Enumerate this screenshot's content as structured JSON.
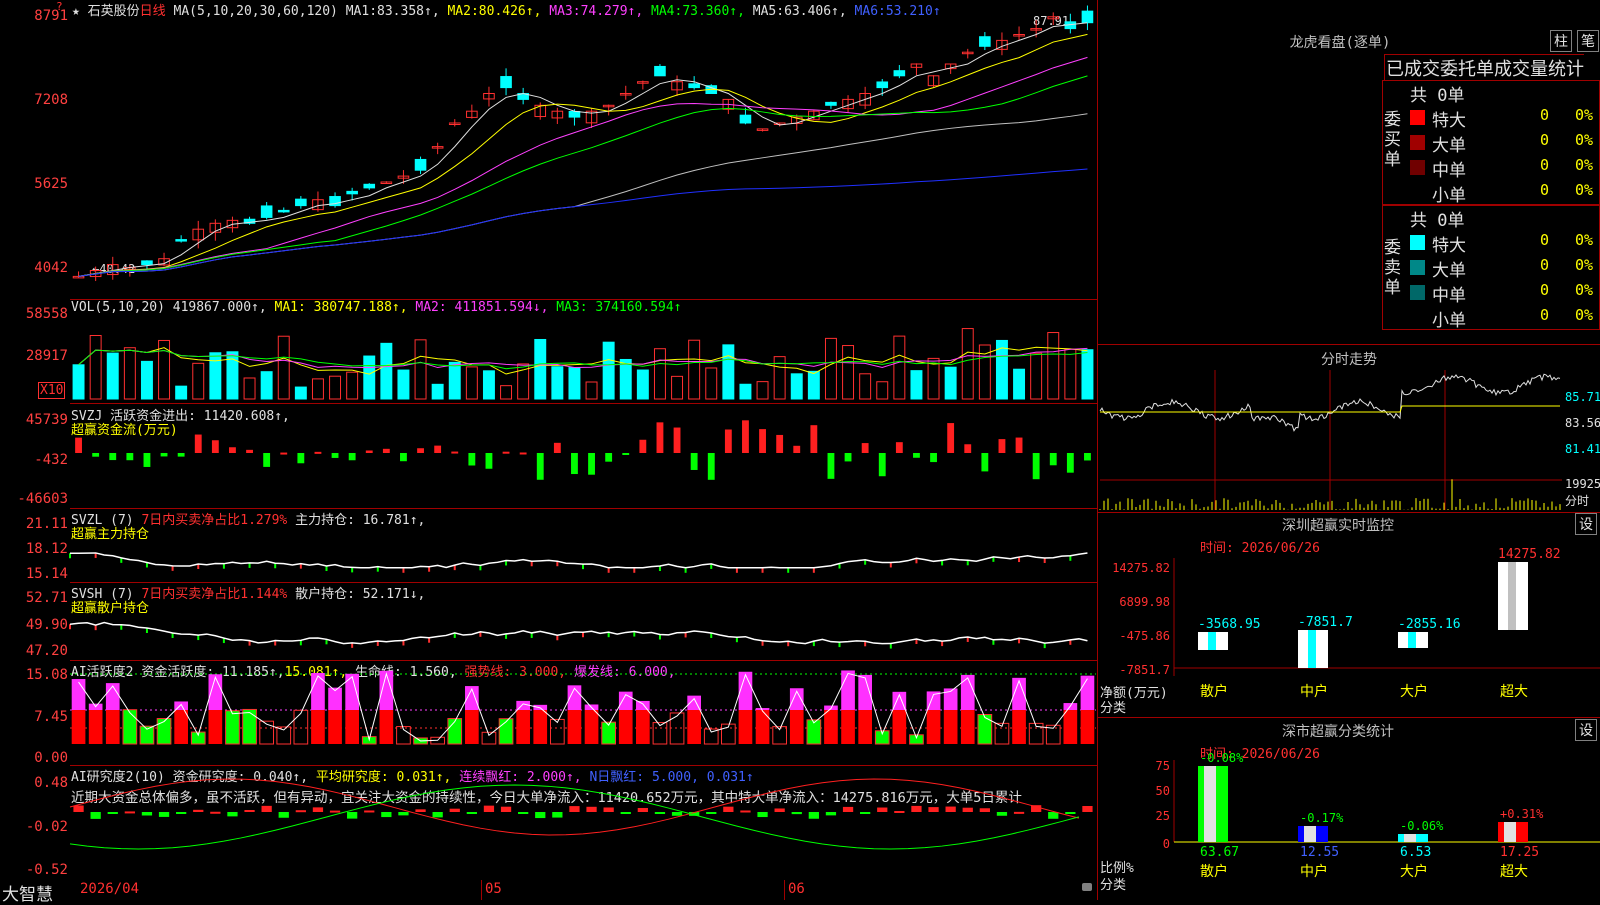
{
  "main": {
    "stock": "石英股份",
    "period": "日线",
    "ma_params": "MA(5,10,20,30,60,120)",
    "ma1_label": "MA1:",
    "ma1": "83.358↑,",
    "ma2_label": "MA2:",
    "ma2": "80.426↑,",
    "ma3_label": "MA3:",
    "ma3": "74.279↑,",
    "ma4_label": "MA4:",
    "ma4": "73.360↑,",
    "ma5_label": "MA5:",
    "ma5": "63.406↑,",
    "ma6_label": "MA6:",
    "ma6": "53.210↑",
    "high_label": "87.91",
    "low_label": "←40.42",
    "axis": [
      "8791",
      "7208",
      "5625",
      "4042"
    ]
  },
  "vol": {
    "params": "VOL(5,10,20)",
    "value": "419867.000↑,",
    "ma1": "MA1: 380747.188↑,",
    "ma2": "MA2: 411851.594↓,",
    "ma3": "MA3: 374160.594↑",
    "axis": [
      "58558",
      "28917"
    ],
    "unit": "X10"
  },
  "svzj": {
    "line1": "SVZJ  活跃资金进出: 11420.608↑,",
    "line2": "超赢资金流(万元)",
    "axis": [
      "45739",
      "-432",
      "-46603"
    ]
  },
  "svzl": {
    "name": "SVZL (7)",
    "pct": "7日内买卖净占比1.279%",
    "hold": "主力持仓: 16.781↑,",
    "line2": "超赢主力持仓",
    "axis": [
      "21.11",
      "18.12",
      "15.14"
    ]
  },
  "svsh": {
    "name": "SVSH (7)",
    "pct": "7日内买卖净占比1.144%",
    "hold": "散户持仓: 52.171↓,",
    "line2": "超赢散户持仓",
    "axis": [
      "52.71",
      "49.90",
      "47.20"
    ]
  },
  "ai2": {
    "name": "AI活跃度2",
    "v1": "资金活跃度: 11.185↑,",
    "v2": "15.081↑,",
    "v3": "生命线: 1.560,",
    "v4": "强势线: 3.000,",
    "v5": "爆发线: 6.000,",
    "axis": [
      "15.08",
      "7.45",
      "0.00"
    ]
  },
  "ai_research": {
    "name": "AI研究度2(10)",
    "v1": "资金研究度: 0.040↑,",
    "v2": "平均研究度: 0.031↑,",
    "v3": "连续飘红: 2.000↑,",
    "v4": "N日飘红: 5.000,",
    "v5": "0.031↑",
    "comment": "近期大资金总体偏多，虽不活跃，但有异动，宜关注大资金的持续性，今日大单净流入：11420.652万元，其中特大单净流入：14275.816万元，大单5日累计",
    "axis": [
      "0.48",
      "-0.02",
      "-0.52"
    ]
  },
  "bottom": {
    "brand": "大智慧",
    "date": "2026/04",
    "m05": "05",
    "m06": "06"
  },
  "right": {
    "lhb_title": "龙虎看盘(逐单)",
    "btn_zhu": "柱",
    "btn_bi": "笔",
    "tabs": "已成交委托单成交量统计",
    "buy_side": "委买单",
    "sell_side": "委卖单",
    "buy_total": "共 0单",
    "sell_total": "共 0单",
    "buy_rows": [
      {
        "label": "特大",
        "count": "0",
        "pct": "0%",
        "color": "#ff0000"
      },
      {
        "label": "大单",
        "count": "0",
        "pct": "0%",
        "color": "#a00000"
      },
      {
        "label": "中单",
        "count": "0",
        "pct": "0%",
        "color": "#700000"
      },
      {
        "label": "小单",
        "count": "0",
        "pct": "0%",
        "color": "#000000"
      }
    ],
    "sell_rows": [
      {
        "label": "特大",
        "count": "0",
        "pct": "0%",
        "color": "#00ffff"
      },
      {
        "label": "大单",
        "count": "0",
        "pct": "0%",
        "color": "#008888"
      },
      {
        "label": "中单",
        "count": "0",
        "pct": "0%",
        "color": "#006868"
      },
      {
        "label": "小单",
        "count": "0",
        "pct": "0%",
        "color": "#000000"
      }
    ],
    "fenshi_title": "分时走势",
    "fenshi_axis": [
      "85.71",
      "83.56",
      "81.41",
      "19925",
      "分时"
    ],
    "sz_title": "深圳超赢实时监控",
    "btn_set": "设",
    "sz_time": "时间: 2026/06/26",
    "sz_axis": [
      "14275.82",
      "6899.98",
      "-475.86",
      "-7851.7"
    ],
    "sz_unit": "净额(万元)",
    "sz_cat_label": "分类",
    "sz_values": [
      "-3568.95",
      "-7851.7",
      "-2855.16",
      "14275.82"
    ],
    "categories": [
      "散户",
      "中户",
      "大户",
      "超大"
    ],
    "cls_title": "深市超赢分类统计",
    "cls_time": "时间: 2026/06/26",
    "cls_axis": [
      "75",
      "50",
      "25",
      "0"
    ],
    "cls_ratio_label": "比例%",
    "cls_pct": [
      "-0.08%",
      "-0.17%",
      "-0.06%",
      "+0.31%"
    ],
    "cls_values": [
      "63.67",
      "12.55",
      "6.53",
      "17.25"
    ]
  }
}
